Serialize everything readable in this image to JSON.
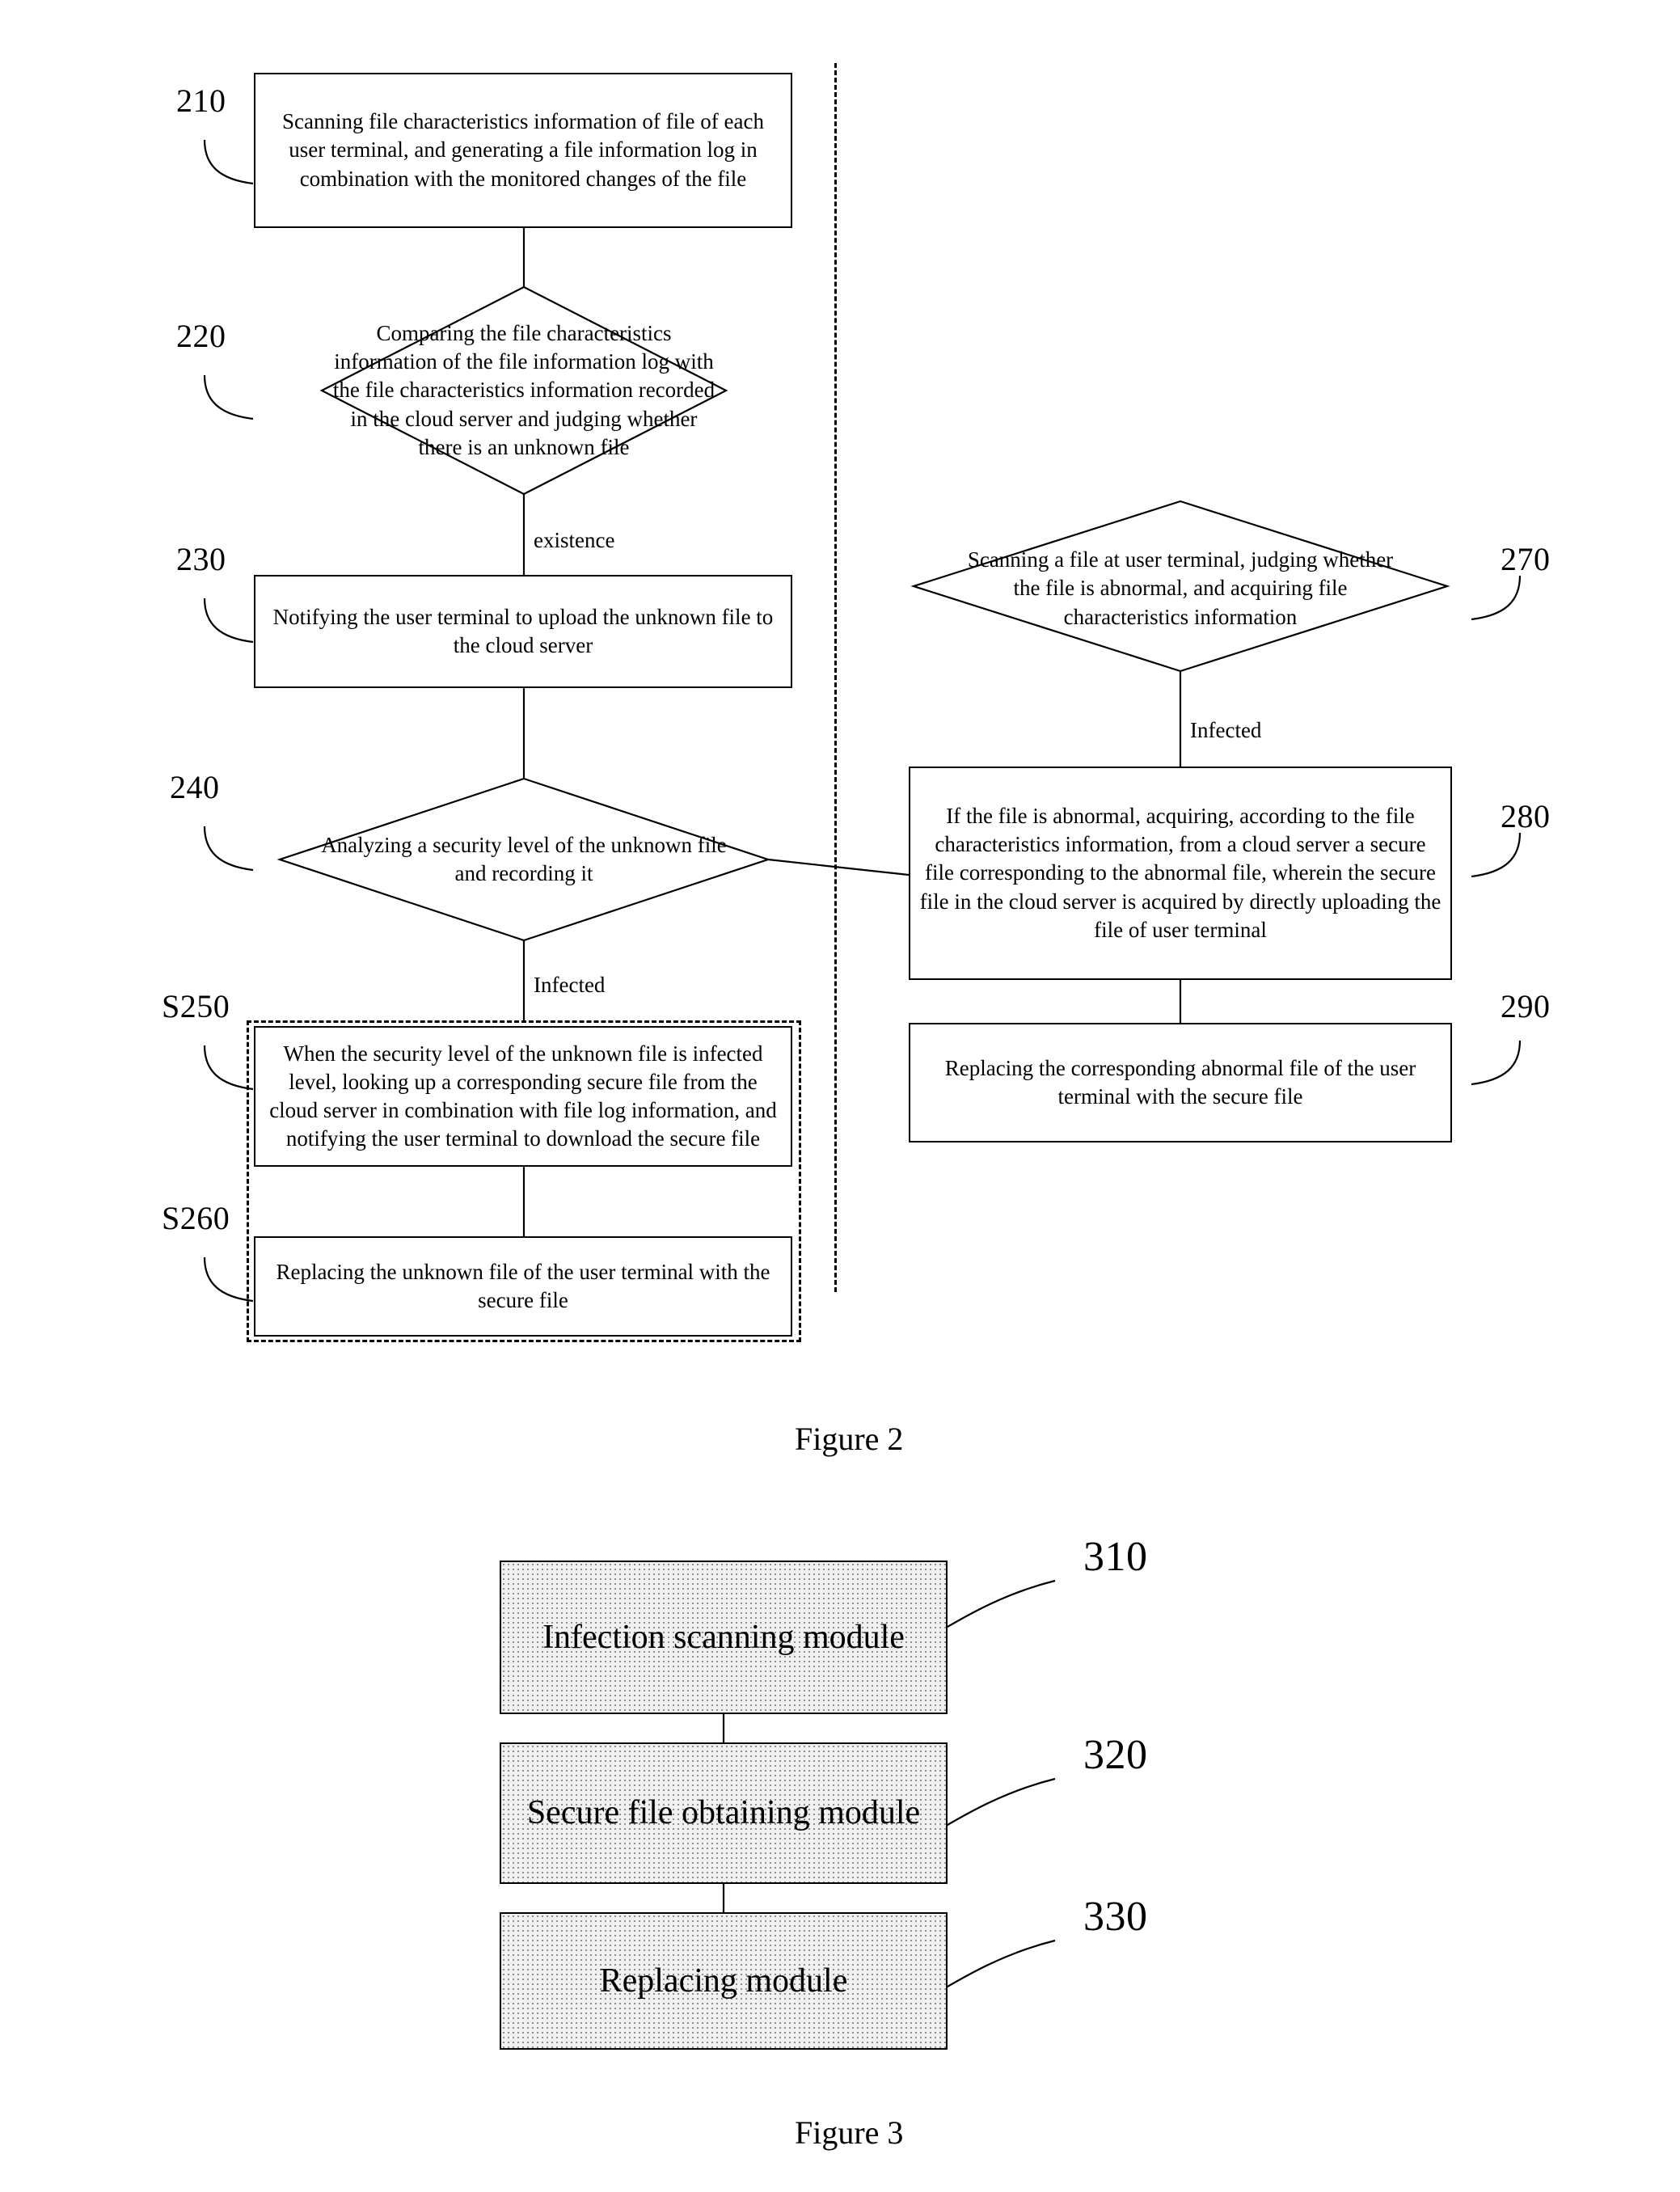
{
  "figure2": {
    "caption": "Figure 2",
    "nodes": {
      "n210": {
        "ref": "210",
        "text": "Scanning file characteristics information of file of each user terminal, and generating a file information log in combination with the monitored changes of the file"
      },
      "n220": {
        "ref": "220",
        "text": "Comparing the file characteristics information of the file information log with the file characteristics information recorded in the cloud server and judging whether there is an unknown file"
      },
      "n230": {
        "ref": "230",
        "text": "Notifying the user terminal to upload the unknown file to the cloud server"
      },
      "n240": {
        "ref": "240",
        "text": "Analyzing a security level of the unknown file and recording it"
      },
      "n250": {
        "ref": "S250",
        "text": "When the security level of the unknown file is infected level, looking up a corresponding secure file from the cloud server in combination with file log information, and notifying the user terminal to download the secure file"
      },
      "n260": {
        "ref": "S260",
        "text": "Replacing the unknown file of the user terminal with the secure file"
      },
      "n270": {
        "ref": "270",
        "text": "Scanning a file at user terminal, judging whether the file is abnormal, and acquiring file characteristics information"
      },
      "n280": {
        "ref": "280",
        "text": "If the file is abnormal, acquiring, according to the file characteristics information, from a cloud server a secure file corresponding to the abnormal file, wherein the secure file in the cloud server is acquired by directly uploading the file of user terminal"
      },
      "n290": {
        "ref": "290",
        "text": "Replacing the corresponding abnormal file of the user terminal with the secure file"
      }
    },
    "edge_labels": {
      "existence": "existence",
      "infected_left": "Infected",
      "infected_right": "Infected"
    }
  },
  "figure3": {
    "caption": "Figure 3",
    "modules": [
      {
        "ref": "310",
        "label": "Infection scanning module"
      },
      {
        "ref": "320",
        "label": "Secure file obtaining module"
      },
      {
        "ref": "330",
        "label": "Replacing module"
      }
    ]
  },
  "colors": {
    "ink": "#000000",
    "paper": "#ffffff",
    "module_fill": "#f0f0f0"
  }
}
